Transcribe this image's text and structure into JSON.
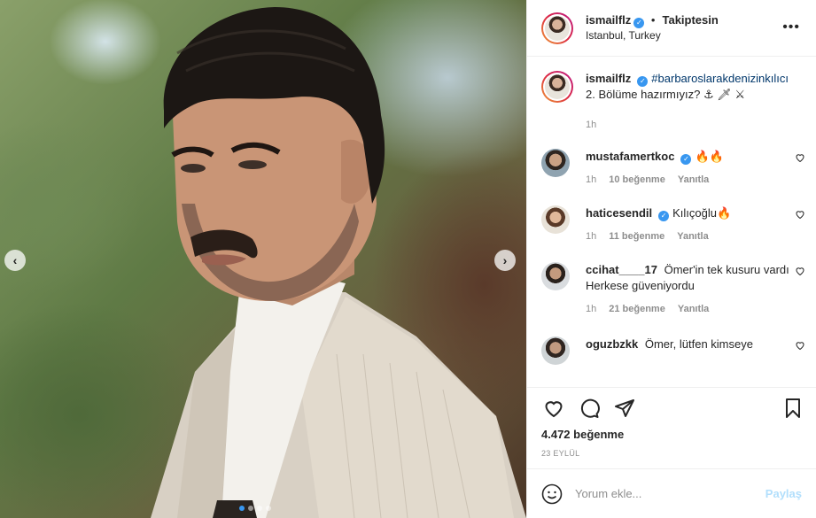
{
  "post_author": {
    "username": "ismailflz",
    "follow_status": "Takiptesin",
    "location": "Istanbul, Turkey"
  },
  "caption": {
    "username": "ismailflz",
    "hashtag": "#barbaroslarakdenizinkılıcı",
    "text": "2. Bölüme hazırmıyız?",
    "emojis": "⚓ 🗡 ⚔",
    "time": "1h"
  },
  "comments": [
    {
      "username": "mustafamertkoc",
      "verified": true,
      "text": "🔥🔥",
      "time": "1h",
      "likes": "10 beğenme",
      "reply": "Yanıtla"
    },
    {
      "username": "haticesendil",
      "verified": true,
      "text": "Kılıçoğlu🔥",
      "time": "1h",
      "likes": "11 beğenme",
      "reply": "Yanıtla"
    },
    {
      "username": "ccihat____17",
      "verified": false,
      "text": "Ömer'in tek kusuru vardı Herkese güveniyordu",
      "time": "1h",
      "likes": "21 beğenme",
      "reply": "Yanıtla"
    },
    {
      "username": "oguzbzkk",
      "verified": false,
      "text": "Ömer, lütfen kimseye",
      "time": "",
      "likes": "",
      "reply": ""
    }
  ],
  "likes_count": "4.472 beğenme",
  "date": "23 EYLÜL",
  "comment_input": {
    "placeholder": "Yorum ekle...",
    "post_label": "Paylaş"
  },
  "carousel": {
    "prev": "‹",
    "next": "›",
    "slides": 4,
    "active_slide": 1
  },
  "colors": {
    "verified": "#3897f0",
    "hashtag": "#00376b",
    "post_button_disabled": "#b2dffc",
    "meta_text": "#8e8e8e"
  },
  "icons": [
    "more-icon",
    "heart-icon",
    "comment-icon",
    "share-icon",
    "bookmark-icon",
    "emoji-icon",
    "verified-icon"
  ]
}
